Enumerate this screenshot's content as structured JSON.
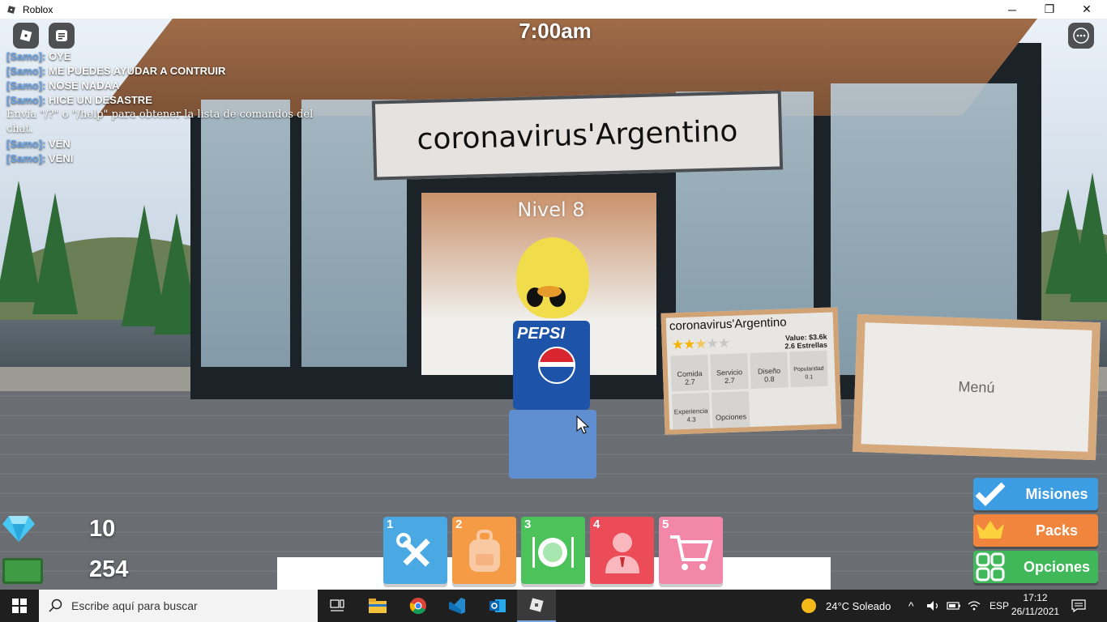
{
  "window": {
    "title": "Roblox",
    "controls": {
      "minimize": "─",
      "maximize": "❐",
      "close": "✕"
    }
  },
  "game": {
    "clock": "7:00am",
    "restaurant_sign": "coronavirus'Argentino",
    "level_label": "Nivel 8",
    "chat": {
      "messages": [
        {
          "user": "[Samo]:",
          "text": "OYE"
        },
        {
          "user": "[Samo]:",
          "text": "ME PUEDES AYUDAR A CONTRUIR"
        },
        {
          "user": "[Samo]:",
          "text": "NOSE NADAA"
        },
        {
          "user": "[Samo]:",
          "text": "HICE UN DESASTRE"
        },
        {
          "user": "",
          "text": "Envía \"/?\" o \"/help\" para obtener la lista de comandos del chat."
        },
        {
          "user": "[Samo]:",
          "text": "VEN"
        },
        {
          "user": "[Samo]:",
          "text": "VENI"
        }
      ]
    },
    "board": {
      "title": "coronavirus'Argentino",
      "value": "Value: $3.6k",
      "stars_text": "2.6 Estrellas",
      "stars": 2.6,
      "stats": [
        {
          "label": "Comida",
          "value": "2.7"
        },
        {
          "label": "Servicio",
          "value": "2.7"
        },
        {
          "label": "Diseño",
          "value": "0.8"
        },
        {
          "label": "Popularidad",
          "value": "0.1"
        },
        {
          "label": "Experiencia",
          "value": "4.3"
        },
        {
          "label": "Opciones",
          "value": ""
        }
      ]
    },
    "menu_board": "Menú",
    "currency": {
      "gems": "10",
      "cash": "254"
    },
    "hotbar": [
      {
        "num": "1",
        "icon": "tools-icon",
        "color": "#4aa9e3"
      },
      {
        "num": "2",
        "icon": "backpack-icon",
        "color": "#f59a45"
      },
      {
        "num": "3",
        "icon": "plate-icon",
        "color": "#4cc35a"
      },
      {
        "num": "4",
        "icon": "staff-icon",
        "color": "#ec4c57"
      },
      {
        "num": "5",
        "icon": "cart-icon",
        "color": "#f387a8"
      }
    ],
    "side_buttons": [
      {
        "label": "Misiones",
        "icon": "checkmark-icon",
        "color": "#3d9de2"
      },
      {
        "label": "Packs",
        "icon": "crown-icon",
        "color": "#f2853d"
      },
      {
        "label": "Opciones",
        "icon": "grid-icon",
        "color": "#40b85a"
      }
    ]
  },
  "taskbar": {
    "search_placeholder": "Escribe aquí para buscar",
    "weather": "24°C Soleado",
    "language": "ESP",
    "time": "17:12",
    "date": "26/11/2021"
  }
}
